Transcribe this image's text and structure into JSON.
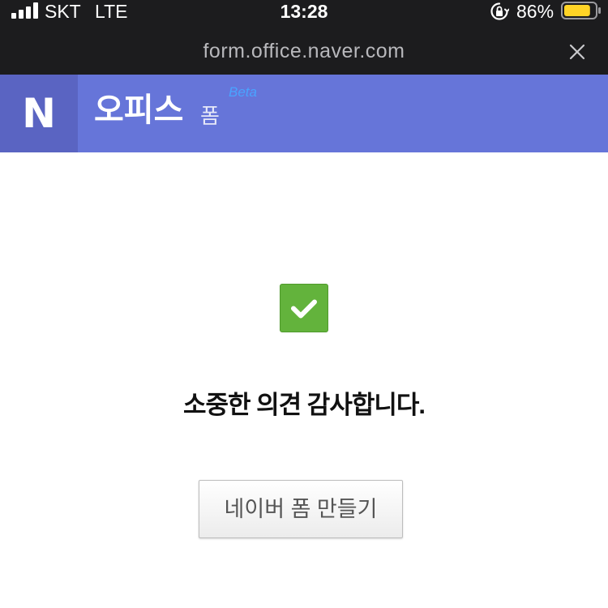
{
  "status_bar": {
    "carrier": "SKT",
    "network": "LTE",
    "time": "13:28",
    "battery_percent": "86%",
    "battery_level": 0.86,
    "icons": [
      "signal-icon",
      "orientation-lock-icon",
      "battery-icon"
    ]
  },
  "browser": {
    "url": "form.office.naver.com",
    "close_icon": "close-icon"
  },
  "header": {
    "logo_letter": "N",
    "title": "오피스",
    "subtitle": "폼",
    "badge": "Beta"
  },
  "main": {
    "status_icon": "checkmark-icon",
    "message": "소중한 의견 감사합니다.",
    "create_button_label": "네이버 폼 만들기"
  },
  "colors": {
    "header_bg": "#6675d9",
    "logo_bg": "#5a64c2",
    "check_green": "#63b33c",
    "battery_yellow": "#ffd426"
  }
}
